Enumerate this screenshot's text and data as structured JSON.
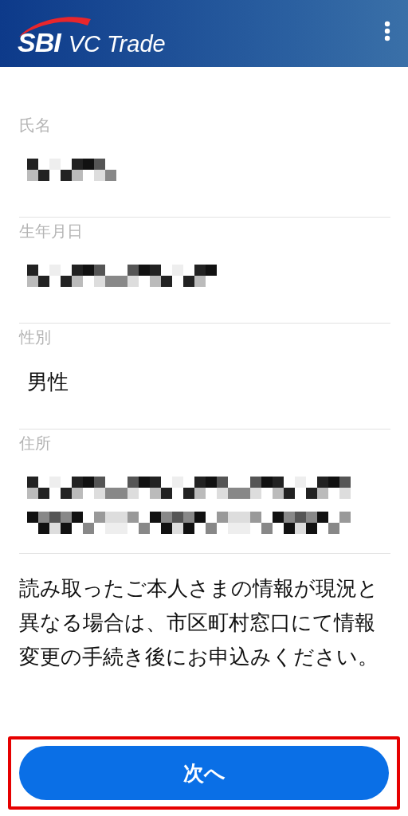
{
  "header": {
    "logo_mark": "SBI",
    "logo_text": "VC Trade"
  },
  "fields": [
    {
      "label": "氏名",
      "kind": "redacted_short"
    },
    {
      "label": "生年月日",
      "kind": "redacted"
    },
    {
      "label": "性別",
      "kind": "text",
      "value": "男性"
    },
    {
      "label": "住所",
      "kind": "redacted_wrapped"
    }
  ],
  "notice": "読み取ったご本人さまの情報が現況と異なる場合は、市区町村窓口にて情報変更の手続き後にお申込みください。",
  "next_button": {
    "label": "次へ",
    "highlighted": true
  }
}
